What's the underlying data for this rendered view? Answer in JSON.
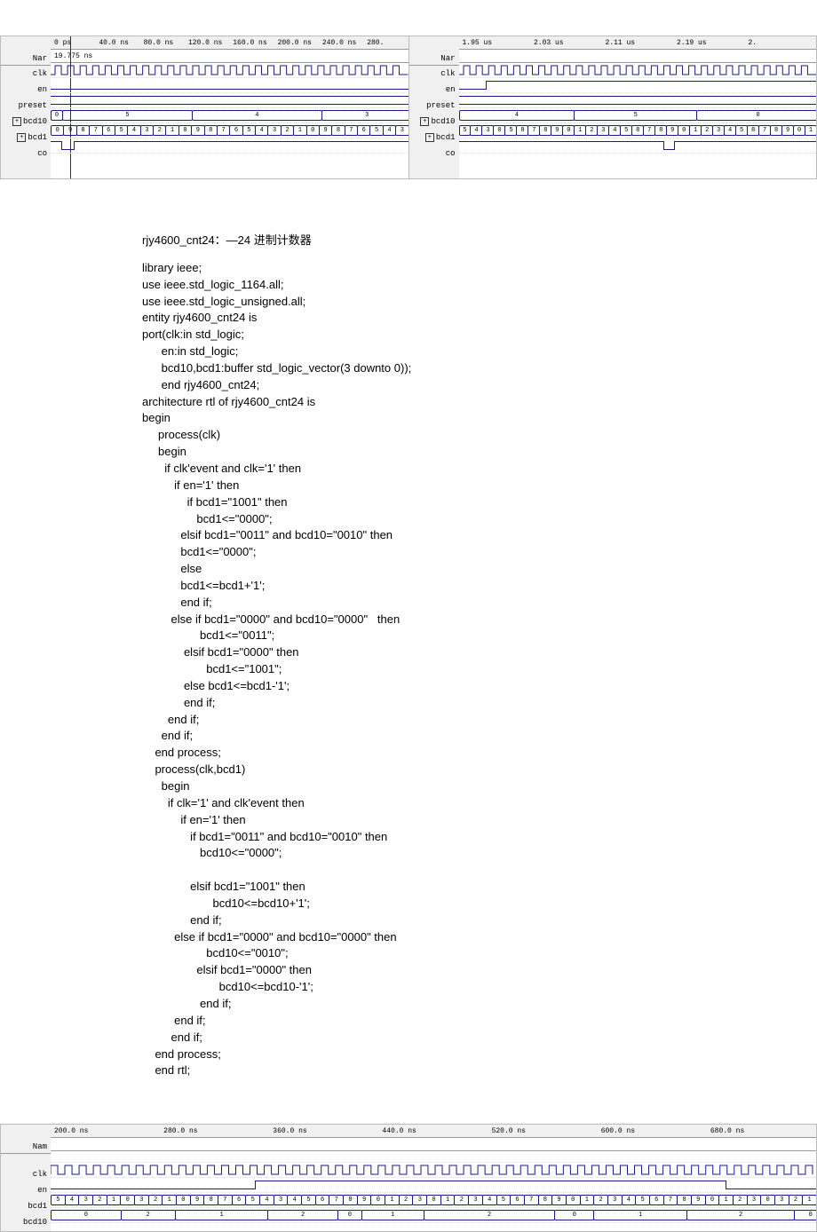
{
  "waveform_top": {
    "left": {
      "header_label": "Nar",
      "cursor_time": "19.775 ns",
      "ruler": [
        "0 ps",
        "40.0 ns",
        "80.0 ns",
        "120.0 ns",
        "160.0 ns",
        "200.0 ns",
        "240.0 ns",
        "280."
      ],
      "signals": [
        "clk",
        "en",
        "preset",
        "bcd10",
        "bcd1",
        "co"
      ],
      "bcd10_values": [
        "0",
        "5",
        "4",
        "3"
      ],
      "bcd1_values": [
        "0",
        "9",
        "8",
        "7",
        "6",
        "5",
        "4",
        "3",
        "2",
        "1",
        "0",
        "9",
        "8",
        "7",
        "6",
        "5",
        "4",
        "3",
        "2",
        "1",
        "0",
        "9",
        "8",
        "7",
        "6",
        "5",
        "4",
        "3"
      ]
    },
    "right": {
      "header_label": "Nar",
      "ruler_labels": [
        "1.95 us",
        "2.03 us",
        "2.11 us",
        "2.19 us",
        "2."
      ],
      "signals": [
        "clk",
        "en",
        "preset",
        "bcd10",
        "bcd1",
        "co"
      ],
      "bcd10_values": [
        "4",
        "5",
        "0"
      ],
      "bcd1_values": [
        "5",
        "4",
        "3",
        "0",
        "5",
        "8",
        "7",
        "8",
        "9",
        "0",
        "1",
        "2",
        "3",
        "4",
        "5",
        "8",
        "7",
        "8",
        "9",
        "0",
        "1",
        "2",
        "3",
        "4",
        "5",
        "8",
        "7",
        "8",
        "9",
        "0",
        "1"
      ]
    },
    "expandable_signals": [
      "bcd10",
      "bcd1"
    ]
  },
  "code": {
    "title": "rjy4600_cnt24：—24 进制计数器",
    "body": "library ieee;\nuse ieee.std_logic_1164.all;\nuse ieee.std_logic_unsigned.all;\nentity rjy4600_cnt24 is\nport(clk:in std_logic;\n      en:in std_logic;\n      bcd10,bcd1:buffer std_logic_vector(3 downto 0));\n      end rjy4600_cnt24;\narchitecture rtl of rjy4600_cnt24 is\nbegin\n     process(clk)\n     begin\n       if clk'event and clk='1' then\n          if en='1' then\n              if bcd1=\"1001\" then\n                 bcd1<=\"0000\";\n            elsif bcd1=\"0011\" and bcd10=\"0010\" then\n            bcd1<=\"0000\";\n            else\n            bcd1<=bcd1+'1';\n            end if;\n         else if bcd1=\"0000\" and bcd10=\"0000\"   then\n                  bcd1<=\"0011\";\n             elsif bcd1=\"0000\" then\n                    bcd1<=\"1001\";\n             else bcd1<=bcd1-'1';\n             end if;\n        end if;\n      end if;\n    end process;\n    process(clk,bcd1)\n      begin\n        if clk='1' and clk'event then\n            if en='1' then\n               if bcd1=\"0011\" and bcd10=\"0010\" then\n                  bcd10<=\"0000\";\n\n               elsif bcd1=\"1001\" then\n                      bcd10<=bcd10+'1';\n               end if;\n          else if bcd1=\"0000\" and bcd10=\"0000\" then\n                    bcd10<=\"0010\";\n                 elsif bcd1=\"0000\" then\n                        bcd10<=bcd10-'1';\n                  end if;\n          end if;\n         end if;\n    end process;\n    end rtl;"
  },
  "waveform_bottom": {
    "header_label": "Nam",
    "ruler_labels": [
      "200.0 ns",
      "280.0 ns",
      "360.0 ns",
      "440.0 ns",
      "520.0 ns",
      "600.0 ns",
      "680.0 ns"
    ],
    "signals": [
      "clk",
      "en",
      "bcd1",
      "bcd10"
    ],
    "bcd1_values": [
      "5",
      "4",
      "3",
      "2",
      "1",
      "0",
      "3",
      "2",
      "1",
      "0",
      "9",
      "8",
      "7",
      "6",
      "5",
      "4",
      "3",
      "4",
      "5",
      "6",
      "7",
      "8",
      "9",
      "0",
      "1",
      "2",
      "3",
      "0",
      "1",
      "2",
      "3",
      "4",
      "5",
      "6",
      "7",
      "8",
      "9",
      "0",
      "1",
      "2",
      "3",
      "4",
      "5",
      "6",
      "7",
      "8",
      "9",
      "0",
      "1",
      "2",
      "3",
      "0",
      "3",
      "2",
      "1"
    ],
    "bcd10_values": [
      "0",
      "2",
      "1",
      "2",
      "0",
      "1",
      "2",
      "0",
      "1",
      "2",
      "0"
    ]
  }
}
